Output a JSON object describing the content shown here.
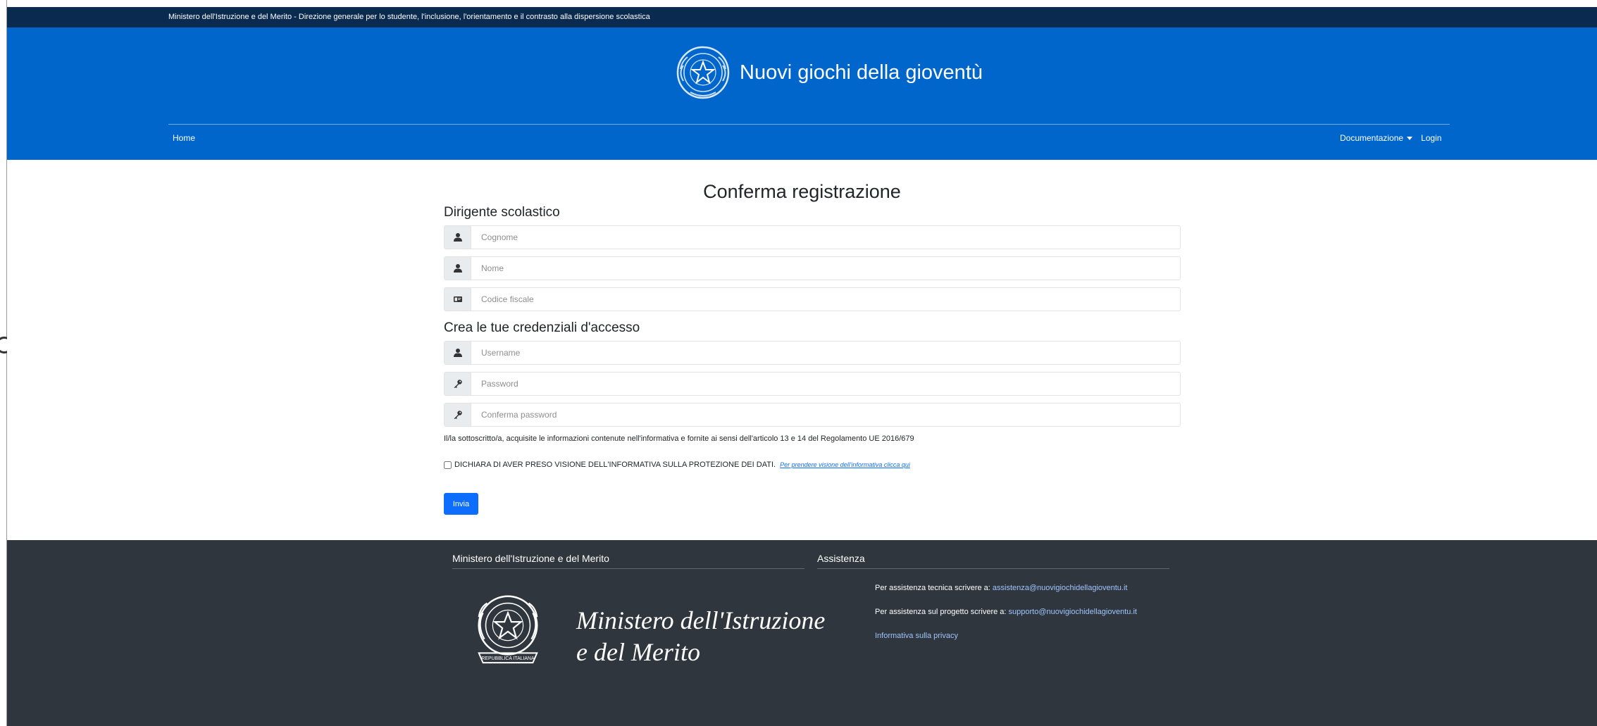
{
  "topbar": {
    "text": "Ministero dell'Istruzione e del Merito - Direzione generale per lo studente, l'inclusione, l'orientamento e il contrasto alla dispersione scolastica"
  },
  "header": {
    "title": "Nuovi giochi della gioventù",
    "nav": {
      "home": "Home",
      "documentation": "Documentazione",
      "login": "Login"
    }
  },
  "form": {
    "title": "Conferma registrazione",
    "section_dirigente": "Dirigente scolastico",
    "cognome_placeholder": "Cognome",
    "nome_placeholder": "Nome",
    "codice_fiscale_placeholder": "Codice fiscale",
    "section_credentials": "Crea le tue credenziali d'accesso",
    "username_placeholder": "Username",
    "password_placeholder": "Password",
    "confirm_password_placeholder": "Conferma password",
    "consent_text": "Il/la sottoscritto/a, acquisite le informazioni contenute nell'informativa e fornite ai sensi dell'articolo 13 e 14 del Regolamento UE 2016/679",
    "declare_text": "DICHIARA DI AVER PRESO VISIONE DELL'INFORMATIVA SULLA PROTEZIONE DEI DATI.",
    "declare_link": "Per prendere visione dell'informativa clicca qui",
    "declare_checked": false,
    "submit_label": "Invia"
  },
  "footer": {
    "ministry_heading": "Ministero dell'Istruzione e del Merito",
    "ministry_name_line1": "Ministero dell'Istruzione",
    "ministry_name_line2": "e del Merito",
    "ministry_seal_text": "REPUBBLICA ITALIANA",
    "assistance_heading": "Assistenza",
    "tech_label": "Per assistenza tecnica scrivere a:",
    "tech_email": "assistenza@nuovigiochidellagioventu.it",
    "project_label": "Per assistenza sul progetto scrivere a:",
    "project_email": "supporto@nuovigiochidellagioventu.it",
    "privacy_link": "Informativa sulla privacy"
  },
  "colors": {
    "topbar": "#0b2a4f",
    "header": "#0066cc",
    "footer": "#30363d",
    "button": "#0d6efd"
  }
}
